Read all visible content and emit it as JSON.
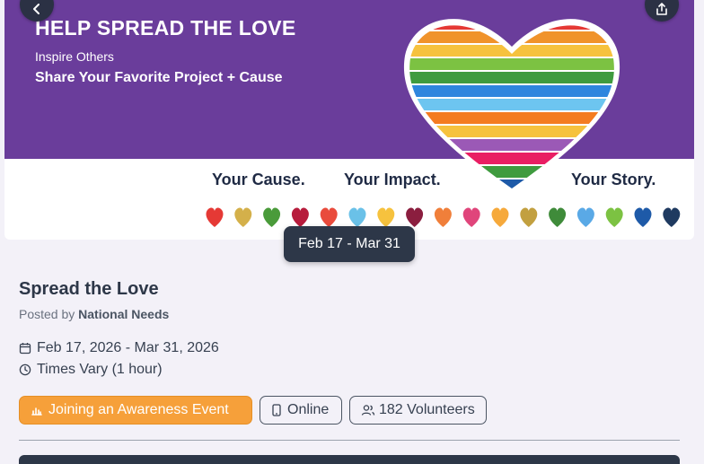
{
  "banner": {
    "headline": "HELP SPREAD THE LOVE",
    "subline1": "Inspire Others",
    "subline2": "Share Your Favorite Project + Cause",
    "tag1": "Your Cause.",
    "tag2": "Your Impact.",
    "tag3": "Your Story.",
    "stripe_colors": [
      "#e53935",
      "#f0932b",
      "#f6c23e",
      "#7cc242",
      "#3f9b3f",
      "#2e86de",
      "#6dc5f0",
      "#f47c20",
      "#f6c23e",
      "#9b59b6",
      "#e91e63",
      "#3f9b3f",
      "#1e5aa8"
    ],
    "heart_row_colors": [
      "#e53935",
      "#d4b04a",
      "#4a9b3a",
      "#b71c3c",
      "#e94b3c",
      "#6ac1e8",
      "#f6c23e",
      "#8b1e3f",
      "#f07f3a",
      "#e0457b",
      "#f6a93b",
      "#c2a040",
      "#3f8b3a",
      "#5aa9e6",
      "#7cc242",
      "#1e5aa8",
      "#1f3a60"
    ]
  },
  "nav": {
    "back_icon": "chevron-left-icon",
    "share_icon": "share-icon"
  },
  "event": {
    "date_pill": "Feb 17 - Mar 31",
    "title": "Spread the Love",
    "posted_by_label": "Posted by",
    "organization": "National Needs",
    "date_range": "Feb 17, 2026 - Mar 31, 2026",
    "times": "Times Vary (1 hour)"
  },
  "chips": {
    "primary": "Joining an Awareness Event",
    "online": "Online",
    "volunteers": "182 Volunteers"
  },
  "colors": {
    "banner_purple": "#6a3d9b",
    "dark": "#2d3748",
    "accent_orange": "#f6a03a"
  }
}
